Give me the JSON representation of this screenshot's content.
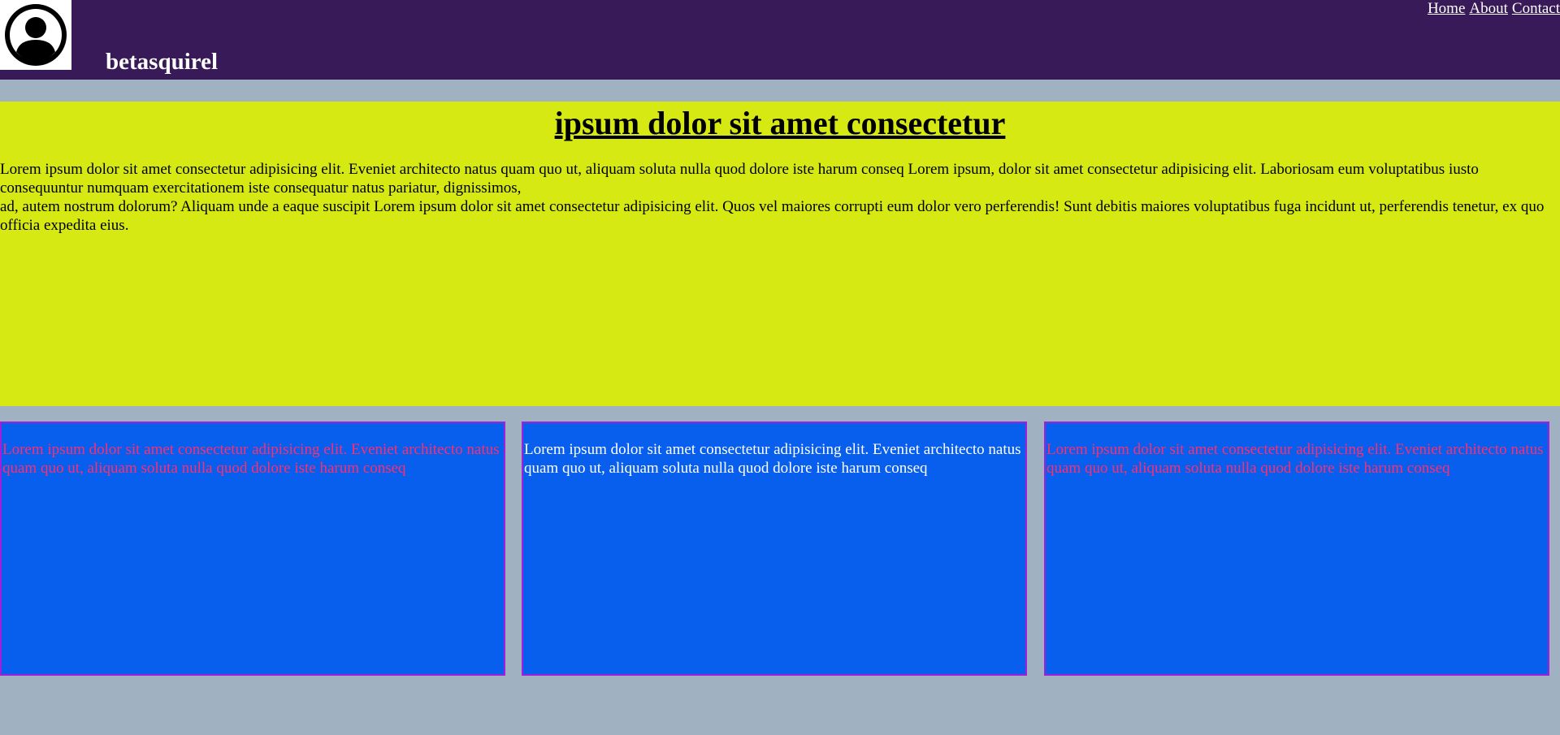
{
  "header": {
    "site_name": "betasquirel",
    "logo_icon": "user-avatar-icon",
    "background": "#381a58"
  },
  "nav": {
    "items": [
      {
        "label": "Home"
      },
      {
        "label": "About"
      },
      {
        "label": "Contact"
      }
    ]
  },
  "hero": {
    "title": "ipsum dolor sit amet consectetur",
    "paragraph_1": "Lorem ipsum dolor sit amet consectetur adipisicing elit. Eveniet architecto natus quam quo ut, aliquam soluta nulla quod dolore iste harum conseq Lorem ipsum, dolor sit amet consectetur adipisicing elit. Laboriosam eum voluptatibus iusto consequuntur numquam exercitationem iste consequatur natus pariatur, dignissimos,",
    "paragraph_2": "ad, autem nostrum dolorum? Aliquam unde a eaque suscipit Lorem ipsum dolor sit amet consectetur adipisicing elit. Quos vel maiores corrupti eum dolor vero perferendis! Sunt debitis maiores voluptatibus fuga incidunt ut, perferendis tenetur, ex quo officia expedita eius.",
    "background": "#d6e912"
  },
  "cards": [
    {
      "text": "Lorem ipsum dolor sit amet consectetur adipisicing elit. Eveniet architecto natus quam quo ut, aliquam soluta nulla quod dolore iste harum conseq",
      "text_color": "#ff2e6e"
    },
    {
      "text": "Lorem ipsum dolor sit amet consectetur adipisicing elit. Eveniet architecto natus quam quo ut, aliquam soluta nulla quod dolore iste harum conseq",
      "text_color": "#ffffff"
    },
    {
      "text": "Lorem ipsum dolor sit amet consectetur adipisicing elit. Eveniet architecto natus quam quo ut, aliquam soluta nulla quod dolore iste harum conseq",
      "text_color": "#ff2e6e"
    }
  ],
  "colors": {
    "page_background": "#a0b1c1",
    "card_background": "#085eed",
    "card_border": "#a020d8"
  }
}
